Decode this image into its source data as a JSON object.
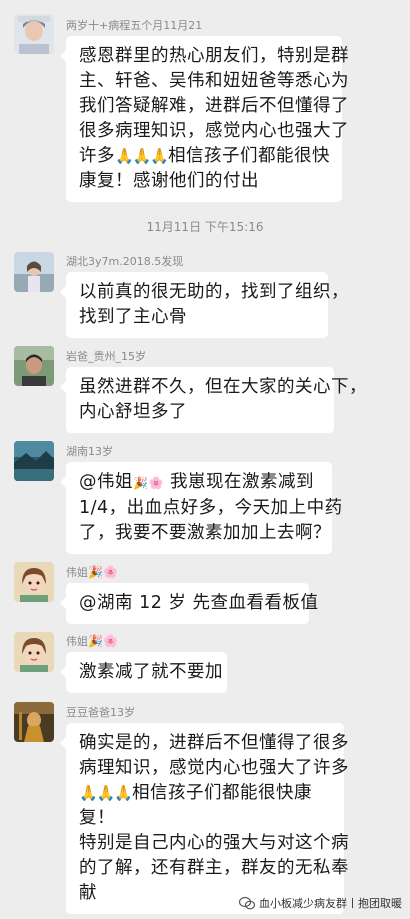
{
  "messages": [
    {
      "sender": "两岁十+病程五个月11月21",
      "lines": [
        "感恩群里的热心朋友们，特别是群",
        "主、轩爸、吴伟和妞妞爸等悉心为",
        "我们答疑解难，进群后不但懂得了",
        "很多病理知识，感觉内心也强大了",
        "许多",
        "相信孩子们都能很快",
        "康复！感谢他们的付出"
      ]
    },
    {
      "sender": "湖北3y7m.2018.5发现",
      "lines": [
        "以前真的很无助的，找到了组织，",
        "找到了主心骨"
      ]
    },
    {
      "sender": "岩爸_贵州_15岁",
      "lines": [
        "虽然进群不久，但在大家的关心下，",
        "内心舒坦多了"
      ]
    },
    {
      "sender": "湖南13岁",
      "lines": [
        "@伟姐",
        "我崽现在激素减到",
        "1/4，出血点好多，今天加上中药",
        "了，我要不要激素加加上去啊？"
      ]
    },
    {
      "sender": "伟姐",
      "lines": [
        "@湖南 12 岁  先查血看看板值"
      ]
    },
    {
      "sender": "伟姐",
      "lines": [
        "激素减了就不要加"
      ]
    },
    {
      "sender": "豆豆爸爸13岁",
      "lines": [
        "确实是的，进群后不但懂得了很多",
        "病理知识，感觉内心也强大了许多",
        "相信孩子们都能很快康",
        "复！",
        "特别是自己内心的强大与对这个病",
        "的了解，还有群主，群友的无私奉",
        "献"
      ]
    }
  ],
  "timestamp": "11月11日 下午15:16",
  "watermark": "血小板减少病友群丨抱团取暖",
  "colors": {
    "background": "#ededed",
    "bubble": "#ffffff",
    "sender": "#8a8a8a"
  }
}
